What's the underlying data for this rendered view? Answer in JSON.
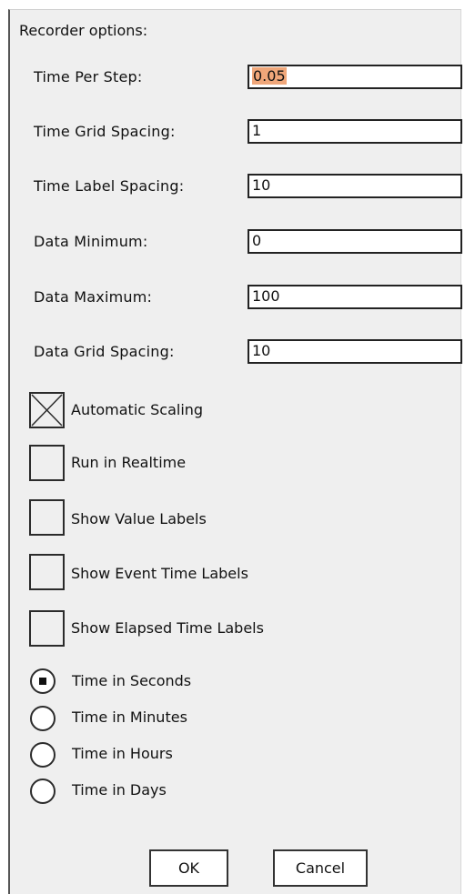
{
  "dialog": {
    "title": "Recorder options:"
  },
  "fields": [
    {
      "label": "Time Per Step:",
      "value": "0.05",
      "selected": true
    },
    {
      "label": "Time Grid Spacing:",
      "value": "1"
    },
    {
      "label": "Time Label Spacing:",
      "value": "10"
    },
    {
      "label": "Data Minimum:",
      "value": "0"
    },
    {
      "label": "Data Maximum:",
      "value": "100"
    },
    {
      "label": "Data Grid Spacing:",
      "value": "10"
    }
  ],
  "checkboxes": [
    {
      "label": "Automatic Scaling",
      "checked": true
    },
    {
      "label": "Run in Realtime",
      "checked": false
    },
    {
      "label": "Show Value Labels",
      "checked": false
    },
    {
      "label": "Show Event Time Labels",
      "checked": false
    },
    {
      "label": "Show Elapsed Time Labels",
      "checked": false
    }
  ],
  "time_units": {
    "selected": "Time in Seconds",
    "options": [
      {
        "label": "Time in Seconds",
        "selected": true
      },
      {
        "label": "Time in Minutes",
        "selected": false
      },
      {
        "label": "Time in Hours",
        "selected": false
      },
      {
        "label": "Time in Days",
        "selected": false
      }
    ]
  },
  "buttons": {
    "ok_label": "OK",
    "cancel_label": "Cancel"
  },
  "colors": {
    "panel_background": "#efefef",
    "selection_highlight": "#f0a77a",
    "border": "#222222"
  }
}
